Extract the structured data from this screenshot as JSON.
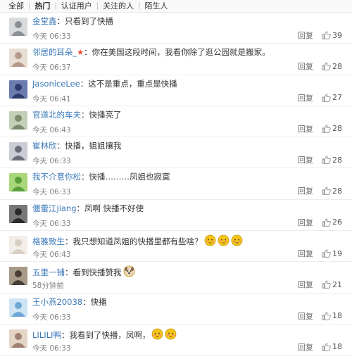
{
  "filters": [
    "全部",
    "热门",
    "认证用户",
    "关注的人",
    "陌生人"
  ],
  "active_filter": "热门",
  "reply_label": "回复",
  "comments": [
    {
      "user": "金堂鑫",
      "user_color": "blue",
      "text": "只看到了快播",
      "time": "今天 06:33",
      "likes": "39",
      "avatar_icon": "avatar-person-icon"
    },
    {
      "user": "邻居的耳朵_",
      "user_color": "blue",
      "badge": "★",
      "text": "你在美国这段时间，我看你除了逛公园就是搬家。",
      "time": "今天 06:37",
      "likes": "28",
      "avatar_icon": "avatar-person-icon"
    },
    {
      "user": "JasoniceLee",
      "user_color": "blue",
      "text": "这不是重点，重点是快播",
      "time": "今天 06:41",
      "likes": "27",
      "avatar_icon": "avatar-city-icon"
    },
    {
      "user": "官道北的车夫",
      "user_color": "blue",
      "text": "快播亮了",
      "time": "今天 06:43",
      "likes": "28",
      "avatar_icon": "avatar-outdoor-icon"
    },
    {
      "user": "崔林欣",
      "user_color": "blue",
      "text": "快播，姐姐攘我",
      "time": "今天 06:33",
      "likes": "28",
      "avatar_icon": "avatar-person-icon"
    },
    {
      "user": "我不介意你松",
      "user_color": "blue",
      "text": "快播………凤姐也寂寞",
      "time": "今天 06:33",
      "likes": "28",
      "avatar_icon": "avatar-frog-icon"
    },
    {
      "user": "僵蕾江jiang",
      "user_color": "blue",
      "text": "凤啊 快播不好使",
      "time": "今天 06:33",
      "likes": "26",
      "avatar_icon": "avatar-dark-icon"
    },
    {
      "user": "格雅致生",
      "user_color": "blue",
      "text": "我只想知道凤姐的快播里都有些啥？",
      "emojis": [
        "shy-face-emoji-icon",
        "shy-face-emoji-icon",
        "shy-face-emoji-icon"
      ],
      "time": "今天 06:43",
      "likes": "19",
      "avatar_icon": "avatar-pale-icon"
    },
    {
      "user": "五里一铺",
      "user_color": "blue",
      "text": "看到快播赞我",
      "emojis": [
        "dog-emoji-icon"
      ],
      "time": "58分钟前",
      "likes": "21",
      "avatar_icon": "avatar-building-icon"
    },
    {
      "user": "王小燕20038",
      "user_color": "blue",
      "text": "快播",
      "time": "今天 06:33",
      "likes": "18",
      "avatar_icon": "avatar-sky-icon"
    },
    {
      "user": "LILILI鸭",
      "user_color": "blue",
      "text": "我看到了快播，凤啊，",
      "emojis": [
        "smirk-face-emoji-icon",
        "smirk-face-emoji-icon"
      ],
      "time": "今天 06:33",
      "likes": "18",
      "avatar_icon": "avatar-person-icon"
    }
  ],
  "colors": {
    "username": "#3a78b8",
    "badge": "#e84a2c",
    "time": "#808080",
    "emoji_yellow": "#f5c518"
  }
}
